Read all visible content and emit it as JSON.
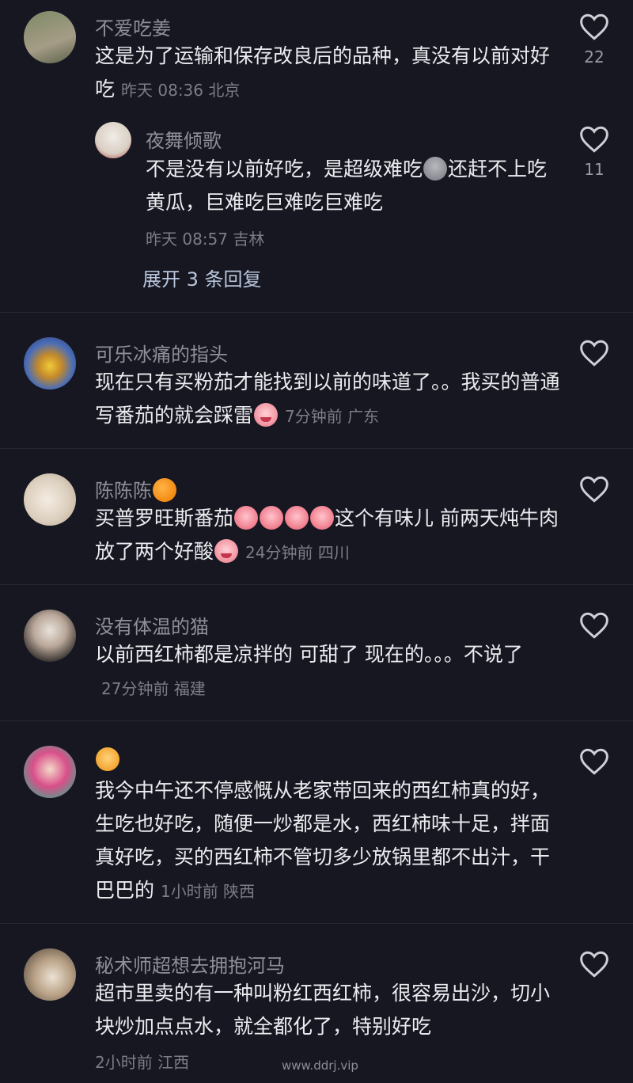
{
  "comments": [
    {
      "author": "不爱吃姜",
      "text": "这是为了运输和保存改良后的品种，真没有以前对好吃",
      "meta": "昨天 08:36 北京",
      "likes": "22",
      "avatar_colors": [
        "#6b7a5a",
        "#a8a08a"
      ]
    },
    {
      "author": "可乐冰痛的指头",
      "text": "现在只有买粉茄才能找到以前的味道了。。我买的普通写番茄的就会踩雷",
      "meta": "7分钟前 广东",
      "avatar_colors": [
        "#3a5fa8",
        "#e8c94a"
      ]
    },
    {
      "author": "陈陈陈",
      "text_a": "买普罗旺斯番茄",
      "text_b": "这个有味儿 前两天炖牛肉放了两个好酸",
      "meta": "24分钟前 四川",
      "avatar_colors": [
        "#e9dfd2",
        "#c9b79c"
      ]
    },
    {
      "author": "没有体温的猫",
      "text": "以前西红柿都是凉拌的 可甜了 现在的。。。不说了",
      "meta": "27分钟前 福建",
      "avatar_colors": [
        "#3b3b3b",
        "#a88f80"
      ]
    },
    {
      "author": "",
      "text": "我今中午还不停感慨从老家带回来的西红柿真的好，生吃也好吃，随便一炒都是水，西红柿味十足，拌面真好吃，买的西红柿不管切多少放锅里都不出汁，干巴巴的",
      "meta": "1小时前 陕西",
      "avatar_colors": [
        "#d94f8a",
        "#4aa38a"
      ]
    },
    {
      "author": "秘术师超想去拥抱河马",
      "text": "超市里卖的有一种叫粉红西红柿，很容易出沙，切小块炒加点点水，就全都化了，特别好吃",
      "meta": "2小时前 江西",
      "avatar_colors": [
        "#8a7b6a",
        "#e8ddd0"
      ]
    }
  ],
  "reply": {
    "author": "夜舞倾歌",
    "text_a": "不是没有以前好吃，是超级难吃",
    "text_b": "还赶不上吃黄瓜，巨难吃巨难吃巨难吃",
    "meta": "昨天 08:57 吉林",
    "likes": "11"
  },
  "expand_label": "展开 3 条回复",
  "watermark": "www.ddrj.vip",
  "icons": {
    "like": "heart-outline-icon",
    "emoji_cry": "crying-face-emoji",
    "emoji_angry": "angry-face-emoji",
    "emoji_grey": "speechless-face-emoji",
    "emoji_orange": "orange-emoji",
    "emoji_tiger": "tiger-emoji"
  },
  "colors": {
    "background": "#161721",
    "author": "#8e8f98",
    "body": "#ececf0",
    "meta": "#7c7d86",
    "expand": "#b9c6dc"
  }
}
